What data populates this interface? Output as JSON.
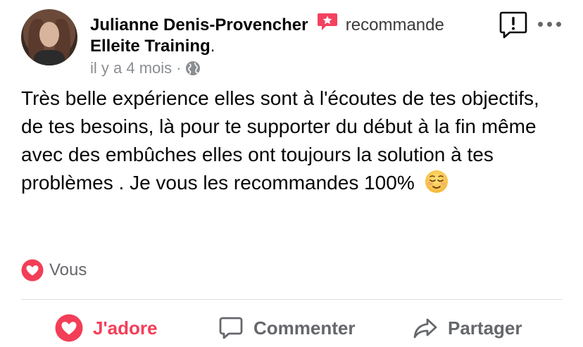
{
  "post": {
    "author": "Julianne Denis-Provencher",
    "action_word": "recommande",
    "page_name": "Elleite Training",
    "page_suffix": ".",
    "time": "il y a 4 mois",
    "separator": "·",
    "privacy_icon": "globe-icon",
    "text_main": "Très belle expérience elles sont à l'écoutes de tes objectifs, de tes besoins, là pour te supporter du début à la fin même avec des embûches elles ont toujours la solution à tes problèmes . Je vous les recommandes 100%",
    "emoji": "relieved-face-emoji"
  },
  "reactions": {
    "icon": "heart-icon",
    "label": "Vous"
  },
  "actions": {
    "like": "J'adore",
    "comment": "Commenter",
    "share": "Partager"
  },
  "colors": {
    "love": "#f33e58",
    "recommend_badge": "#f3425f",
    "secondary_text": "#65676b",
    "divider": "#dadde1"
  }
}
